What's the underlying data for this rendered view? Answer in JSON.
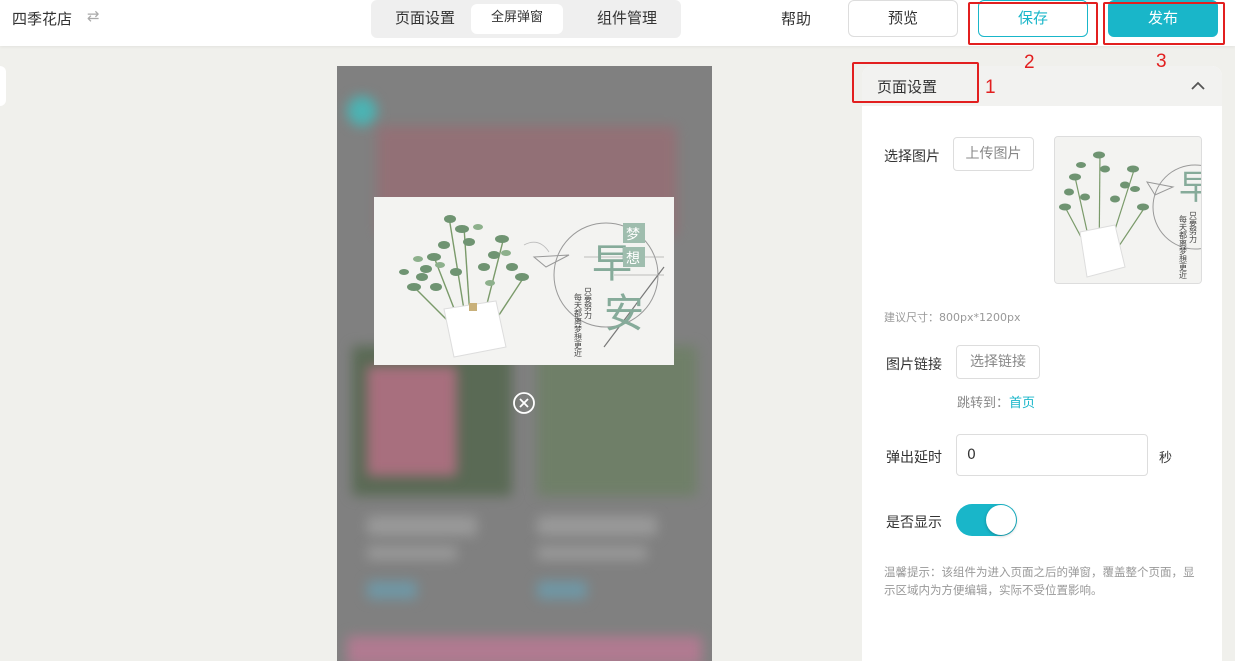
{
  "header": {
    "store_name": "四季花店",
    "switch_icon": "⇄",
    "tabs": [
      "页面设置",
      "全屏弹窗",
      "组件管理"
    ],
    "help": "帮助",
    "preview": "预览",
    "save": "保存",
    "publish": "发布",
    "accent_color": "#19b6c9"
  },
  "annotations": {
    "marks": [
      "1",
      "2",
      "3"
    ],
    "color": "#e21f1f"
  },
  "popup_image": {
    "chars_big": [
      "早",
      "安"
    ],
    "chars_dream": [
      "梦",
      "想"
    ],
    "poem_col1": "只要努力",
    "poem_col2": "每天都离梦想更近"
  },
  "panel": {
    "title": "页面设置",
    "select_image_label": "选择图片",
    "upload_button": "上传图片",
    "size_hint": "建议尺寸：800px*1200px",
    "link_label": "图片链接",
    "choose_link_button": "选择链接",
    "jump_prefix": "跳转到：",
    "jump_target": "首页",
    "delay_label": "弹出延时",
    "delay_value": "0",
    "delay_unit": "秒",
    "show_label": "是否显示",
    "show_enabled": true,
    "tip": "温馨提示：该组件为进入页面之后的弹窗，覆盖整个页面，显示区域内为方便编辑，实际不受位置影响。"
  }
}
